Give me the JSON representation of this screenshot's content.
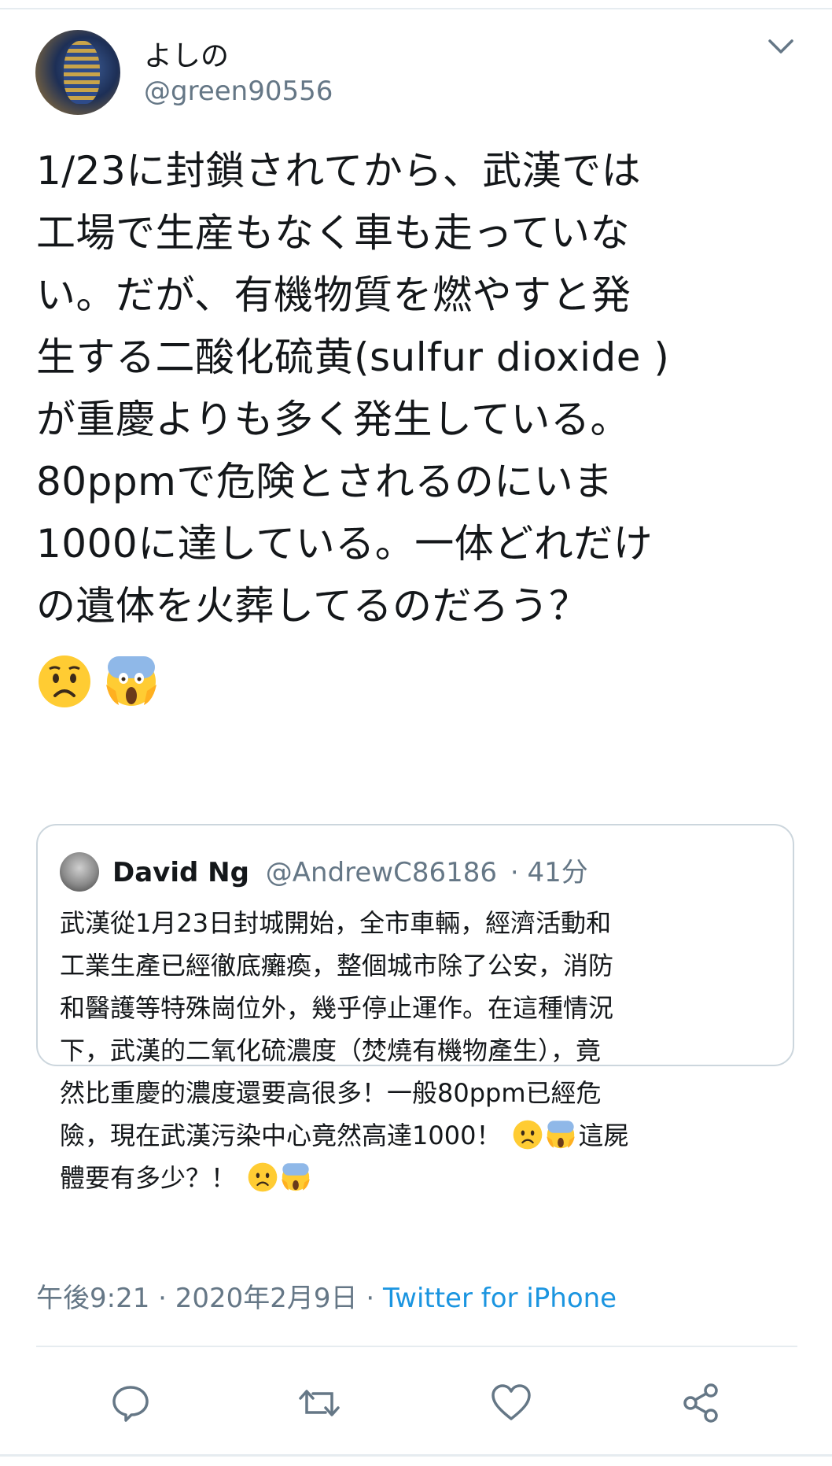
{
  "tweet": {
    "display_name": "よしの",
    "handle": "@green90556",
    "text": "1/23に封鎖されてから、武漢では\n工場で生産もなく車も走っていな\nい。だが、有機物質を燃やすと発\n生する二酸化硫黄(sulfur dioxide )\nが重慶よりも多く発生している。\n80ppmで危険とされるのにいま\n1000に達している。一体どれだけ\nの遺体を火葬してるのだろう？",
    "emojis": [
      "worried-face",
      "face-screaming-in-fear"
    ]
  },
  "quote": {
    "name": "David Ng",
    "handle": "@AndrewC86186",
    "time": "· 41分",
    "text_main": "武漢從1月23日封城開始，全市車輛，經濟活動和\n工業生產已經徹底癱瘓，整個城市除了公安，消防\n和醫護等特殊崗位外，幾乎停止運作。在這種情況\n下，武漢的二氧化硫濃度（焚燒有機物產生），竟\n然比重慶的濃度還要高很多！一般80ppm已經危\n險，現在武漢污染中心竟然高達1000！",
    "text_after_emoji": "這屍\n體要有多少？！"
  },
  "meta": {
    "timestamp": "午後9:21 · 2020年2月9日 ·",
    "source": "Twitter for iPhone"
  },
  "actions": [
    "reply-icon",
    "retweet-icon",
    "like-icon",
    "share-icon"
  ],
  "colors": {
    "link": "#1b95e0",
    "secondary_text": "#657786",
    "border": "#ccd6dd"
  }
}
